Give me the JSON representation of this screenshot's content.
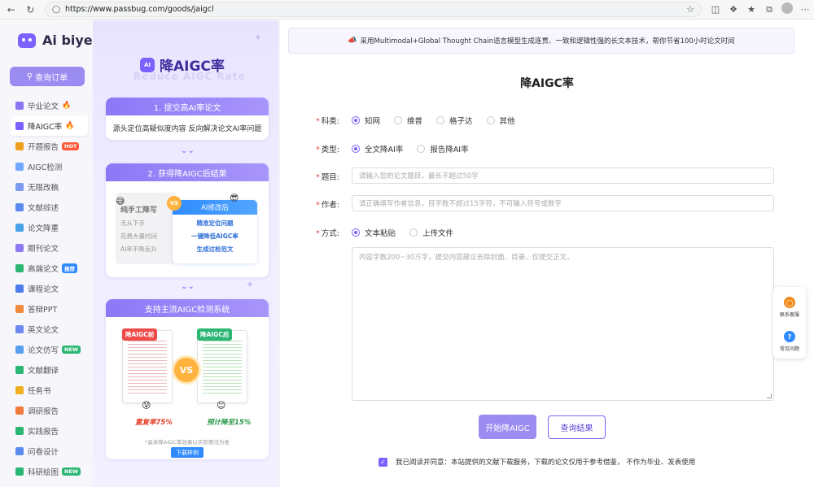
{
  "browser": {
    "url": "https://www.passbug.com/goods/jaigcl",
    "back_icon": "back-arrow-icon",
    "reload_icon": "reload-icon"
  },
  "sidebar": {
    "logo": "Ai biye",
    "query_button": "查询订单",
    "items": [
      {
        "label": "毕业论文",
        "color": "#8a78f0",
        "extra": "fire"
      },
      {
        "label": "降AIGC率",
        "color": "#7b61ff",
        "extra": "fire",
        "active": true
      },
      {
        "label": "开题报告",
        "color": "#f0a020",
        "badge": "HOT",
        "badge_color": "#ff5a3c"
      },
      {
        "label": "AIGC检测",
        "color": "#6fa8ff"
      },
      {
        "label": "无限改稿",
        "color": "#7b9af0"
      },
      {
        "label": "文献综述",
        "color": "#5b8def"
      },
      {
        "label": "论文降重",
        "color": "#4aa3e8"
      },
      {
        "label": "期刊论文",
        "color": "#8a7bf0"
      },
      {
        "label": "高端论文",
        "color": "#2bb673",
        "badge": "推荐",
        "badge_color": "#2f8bff"
      },
      {
        "label": "课程论文",
        "color": "#4c7de8"
      },
      {
        "label": "答辩PPT",
        "color": "#f08a3c"
      },
      {
        "label": "英文论文",
        "color": "#6a8af0"
      },
      {
        "label": "论文仿写",
        "color": "#5aa0f0",
        "badge": "NEW",
        "badge_color": "#2bb673"
      },
      {
        "label": "文献翻译",
        "color": "#2bb673"
      },
      {
        "label": "任务书",
        "color": "#f0b020"
      },
      {
        "label": "调研报告",
        "color": "#f07a3c"
      },
      {
        "label": "实践报告",
        "color": "#2bb673"
      },
      {
        "label": "问卷设计",
        "color": "#5a8cf0"
      },
      {
        "label": "科研绘图",
        "color": "#2bb673",
        "badge": "NEW",
        "badge_color": "#2bb673"
      }
    ]
  },
  "promo": {
    "ai_chip": "AI",
    "title": "降AIGC率",
    "subtitle": "Reduce AIGC Rate",
    "step1_title": "1. 提交高AI率论文",
    "step1_body": "源头定位高疑似度内容 反向解决论文AI率问题",
    "step2_title": "2. 获得降AIGC后结果",
    "manual_title": "纯手工降写",
    "manual_lines": [
      "无从下手",
      "花费大量时间",
      "AI率不降反升"
    ],
    "ai_title": "AI修改后",
    "ai_lines": [
      "精准定位问题",
      "一键降低AIGC率",
      "生成过检范文"
    ],
    "vs": "VS",
    "step3_title": "支持主流AIGC检测系统",
    "before_tag": "降AIGC前",
    "after_tag": "降AIGC后",
    "before_rate": "重复率75%",
    "after_rate": "预计降至15%",
    "note": "*具体降AIGC率效果以实际情况为准",
    "download": "下载样例"
  },
  "main": {
    "notice": "采用Multimodal+Global Thought Chain语言模型生成连贯、一致和逻辑性强的长文本技术，帮你节省100小时论文时间",
    "title": "降AIGC率",
    "subject_label": "科类:",
    "subject_options": [
      "知网",
      "维普",
      "格子达",
      "其他"
    ],
    "type_label": "类型:",
    "type_options": [
      "全文降AI率",
      "报告降AI率"
    ],
    "topic_label": "题目:",
    "topic_placeholder": "请输入您的论文题目，最长不超过50字",
    "author_label": "作者:",
    "author_placeholder": "请正确填写作者信息，目字数不超过15字符，不可输入符号或数字",
    "method_label": "方式:",
    "method_options": [
      "文本粘贴",
      "上传文件"
    ],
    "content_placeholder": "内容字数200~30万字，提交内容建议去除封面、目录、仅提交正文。",
    "start_button": "开始降AIGC",
    "query_button": "查询结果",
    "agree_text": "我已阅读并同意：本站提供的文献下载服务，下载的论文仅用于参考借鉴， 不作为毕业、发表使用"
  },
  "float": {
    "service_label": "联系客服",
    "faq_label": "常见问题"
  }
}
